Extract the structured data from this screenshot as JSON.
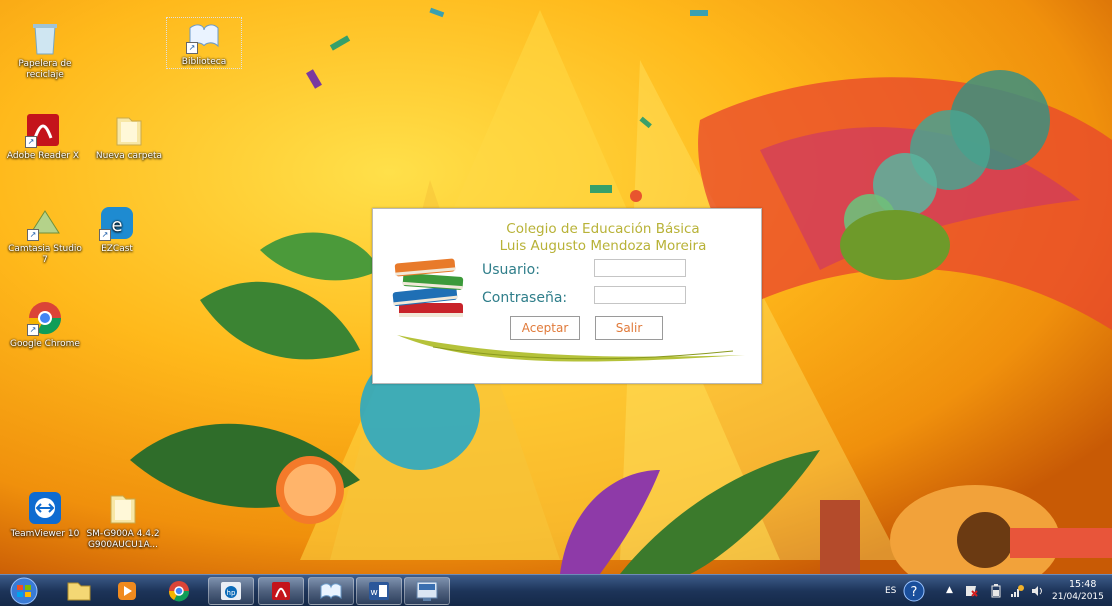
{
  "desktop_icons": [
    {
      "label": "Papelera de reciclaje",
      "icon": "recycle-bin-icon"
    },
    {
      "label": "Biblioteca",
      "icon": "library-shortcut-icon"
    },
    {
      "label": "Adobe Reader X",
      "icon": "adobe-reader-icon"
    },
    {
      "label": "Nueva carpeta",
      "icon": "folder-icon"
    },
    {
      "label": "Camtasia Studio 7",
      "icon": "camtasia-icon"
    },
    {
      "label": "EZCast",
      "icon": "ezcast-icon"
    },
    {
      "label": "Google Chrome",
      "icon": "chrome-icon"
    },
    {
      "label": "TeamViewer 10",
      "icon": "teamviewer-icon"
    },
    {
      "label": "SM-G900A 4.4.2 G900AUCU1A...",
      "icon": "folder-icon"
    }
  ],
  "login": {
    "school_line1": "Colegio de Educación Básica",
    "school_line2": "Luis Augusto Mendoza Moreira",
    "username_label": "Usuario:",
    "password_label": "Contraseña:",
    "username_value": "",
    "password_value": "",
    "accept_label": "Aceptar",
    "exit_label": "Salir"
  },
  "taskbar": {
    "apps": [
      "start-orb-icon",
      "file-explorer-icon",
      "media-player-icon",
      "chrome-icon",
      "hp-icon",
      "adobe-reader-icon",
      "library-app-icon",
      "word-icon",
      "remote-app-icon"
    ],
    "language": "ES",
    "time": "15:48",
    "date": "21/04/2015"
  },
  "colors": {
    "accent_text": "#b8b237",
    "label_text": "#2f7e8a",
    "button_text": "#e07a3a"
  }
}
